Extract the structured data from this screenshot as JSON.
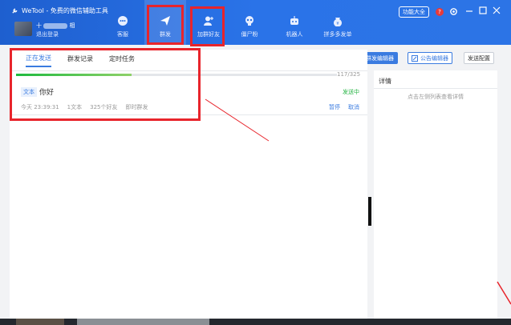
{
  "app": {
    "title": "WeTool - 免费的微信辅助工具"
  },
  "user": {
    "name_prefix": "十",
    "name_suffix": "相",
    "logout": "退出登录"
  },
  "nav": [
    {
      "label": "客服",
      "icon": "chat-icon"
    },
    {
      "label": "群发",
      "icon": "paper-plane-icon"
    },
    {
      "label": "加群好友",
      "icon": "add-user-icon"
    },
    {
      "label": "僵尸粉",
      "icon": "skull-icon"
    },
    {
      "label": "机器人",
      "icon": "robot-icon"
    },
    {
      "label": "拼多多发单",
      "icon": "money-bag-icon"
    }
  ],
  "header_right": {
    "function_button": "功能大全",
    "help_icon": "help-icon"
  },
  "toolbar": {
    "mass_editor": "群发编辑器",
    "notice_editor": "公告编辑器",
    "send_config": "发送配置"
  },
  "tabs": [
    {
      "label": "正在发送"
    },
    {
      "label": "群发记录"
    },
    {
      "label": "定时任务"
    }
  ],
  "task": {
    "progress_text": "117/325",
    "progress_fraction": 0.36,
    "badge": "文本",
    "message": "你好",
    "status": "发送中",
    "time": "今天 23:39:31",
    "count": "1文本",
    "friends": "325个好友",
    "mode": "即时群发",
    "pause": "暂停",
    "cancel": "取消"
  },
  "details": {
    "title": "详情",
    "hint": "点击左侧列表查看详情"
  },
  "colors": {
    "accent": "#3a7be0",
    "highlight": "#e8242b",
    "success": "#28b446"
  }
}
